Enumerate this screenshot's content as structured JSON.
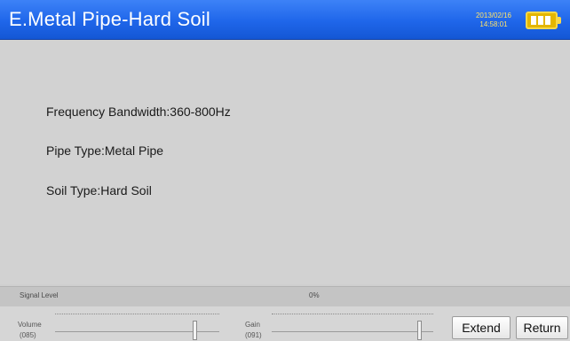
{
  "header": {
    "title": "E.Metal Pipe-Hard Soil",
    "date": "2013/02/16",
    "time": "14:58:01",
    "battery_icon": "battery-full-icon",
    "colors": {
      "bar": "#1f66ea",
      "clock": "#ffe36a",
      "battery": "#e4b600"
    }
  },
  "info": {
    "frequency": "Frequency Bandwidth:360-800Hz",
    "pipe_type": "Pipe Type:Metal Pipe",
    "soil_type": "Soil Type:Hard Soil"
  },
  "signal": {
    "label": "Signal Level",
    "value": "0%"
  },
  "controls": {
    "volume": {
      "label": "Volume",
      "value": "(085)",
      "level_percent": 85
    },
    "gain": {
      "label": "Gain",
      "value": "(091)",
      "level_percent": 91
    }
  },
  "buttons": {
    "extend": "Extend",
    "return": "Return"
  }
}
